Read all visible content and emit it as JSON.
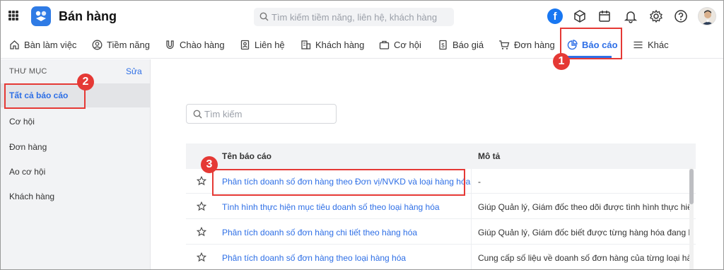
{
  "header": {
    "app_title": "Bán hàng",
    "search_placeholder": "Tìm kiếm tiềm năng, liên hệ, khách hàng",
    "facebook_label": "f"
  },
  "nav": {
    "items": [
      {
        "label": "Bàn làm việc",
        "icon": "home-icon"
      },
      {
        "label": "Tiềm năng",
        "icon": "user-circle-icon"
      },
      {
        "label": "Chào hàng",
        "icon": "magnet-icon"
      },
      {
        "label": "Liên hệ",
        "icon": "contact-card-icon"
      },
      {
        "label": "Khách hàng",
        "icon": "building-icon"
      },
      {
        "label": "Cơ hội",
        "icon": "briefcase-icon"
      },
      {
        "label": "Báo giá",
        "icon": "dollar-doc-icon"
      },
      {
        "label": "Đơn hàng",
        "icon": "cart-icon"
      },
      {
        "label": "Báo cáo",
        "icon": "pie-chart-icon"
      },
      {
        "label": "Khác",
        "icon": "menu-lines-icon"
      }
    ],
    "active_label": "Báo cáo"
  },
  "sidebar": {
    "heading": "THƯ MỤC",
    "edit_label": "Sửa",
    "items": [
      {
        "label": "Tất cả báo cáo",
        "active": true
      },
      {
        "label": "Cơ hội"
      },
      {
        "label": "Đơn hàng"
      },
      {
        "label": "Ao cơ hội"
      },
      {
        "label": "Khách hàng"
      }
    ]
  },
  "main": {
    "search_placeholder": "Tìm kiếm",
    "table": {
      "columns": [
        "Tên báo cáo",
        "Mô tả"
      ],
      "rows": [
        {
          "name": "Phân tích doanh số đơn hàng theo Đơn vị/NVKD và loại hàng hóa",
          "desc": "-"
        },
        {
          "name": "Tình hình thực hiện mục tiêu doanh số theo loại hàng hóa",
          "desc": "Giúp Quản lý, Giám đốc theo dõi được tình hình thực hiện m"
        },
        {
          "name": "Phân tích doanh số đơn hàng chi tiết theo hàng hóa",
          "desc": "Giúp Quản lý, Giám đốc biết được từng hàng hóa đang bán"
        },
        {
          "name": "Phân tích doanh số đơn hàng theo loại hàng hóa",
          "desc": "Cung cấp số liệu về doanh số đơn hàng của từng loại hàng"
        }
      ]
    }
  },
  "annotations": {
    "step1": "1",
    "step2": "2",
    "step3": "3",
    "color": "#e53935"
  },
  "colors": {
    "accent": "#2e6fe6",
    "sidebar_bg": "#f2f3f5",
    "logo_bg": "#2f7be5"
  }
}
